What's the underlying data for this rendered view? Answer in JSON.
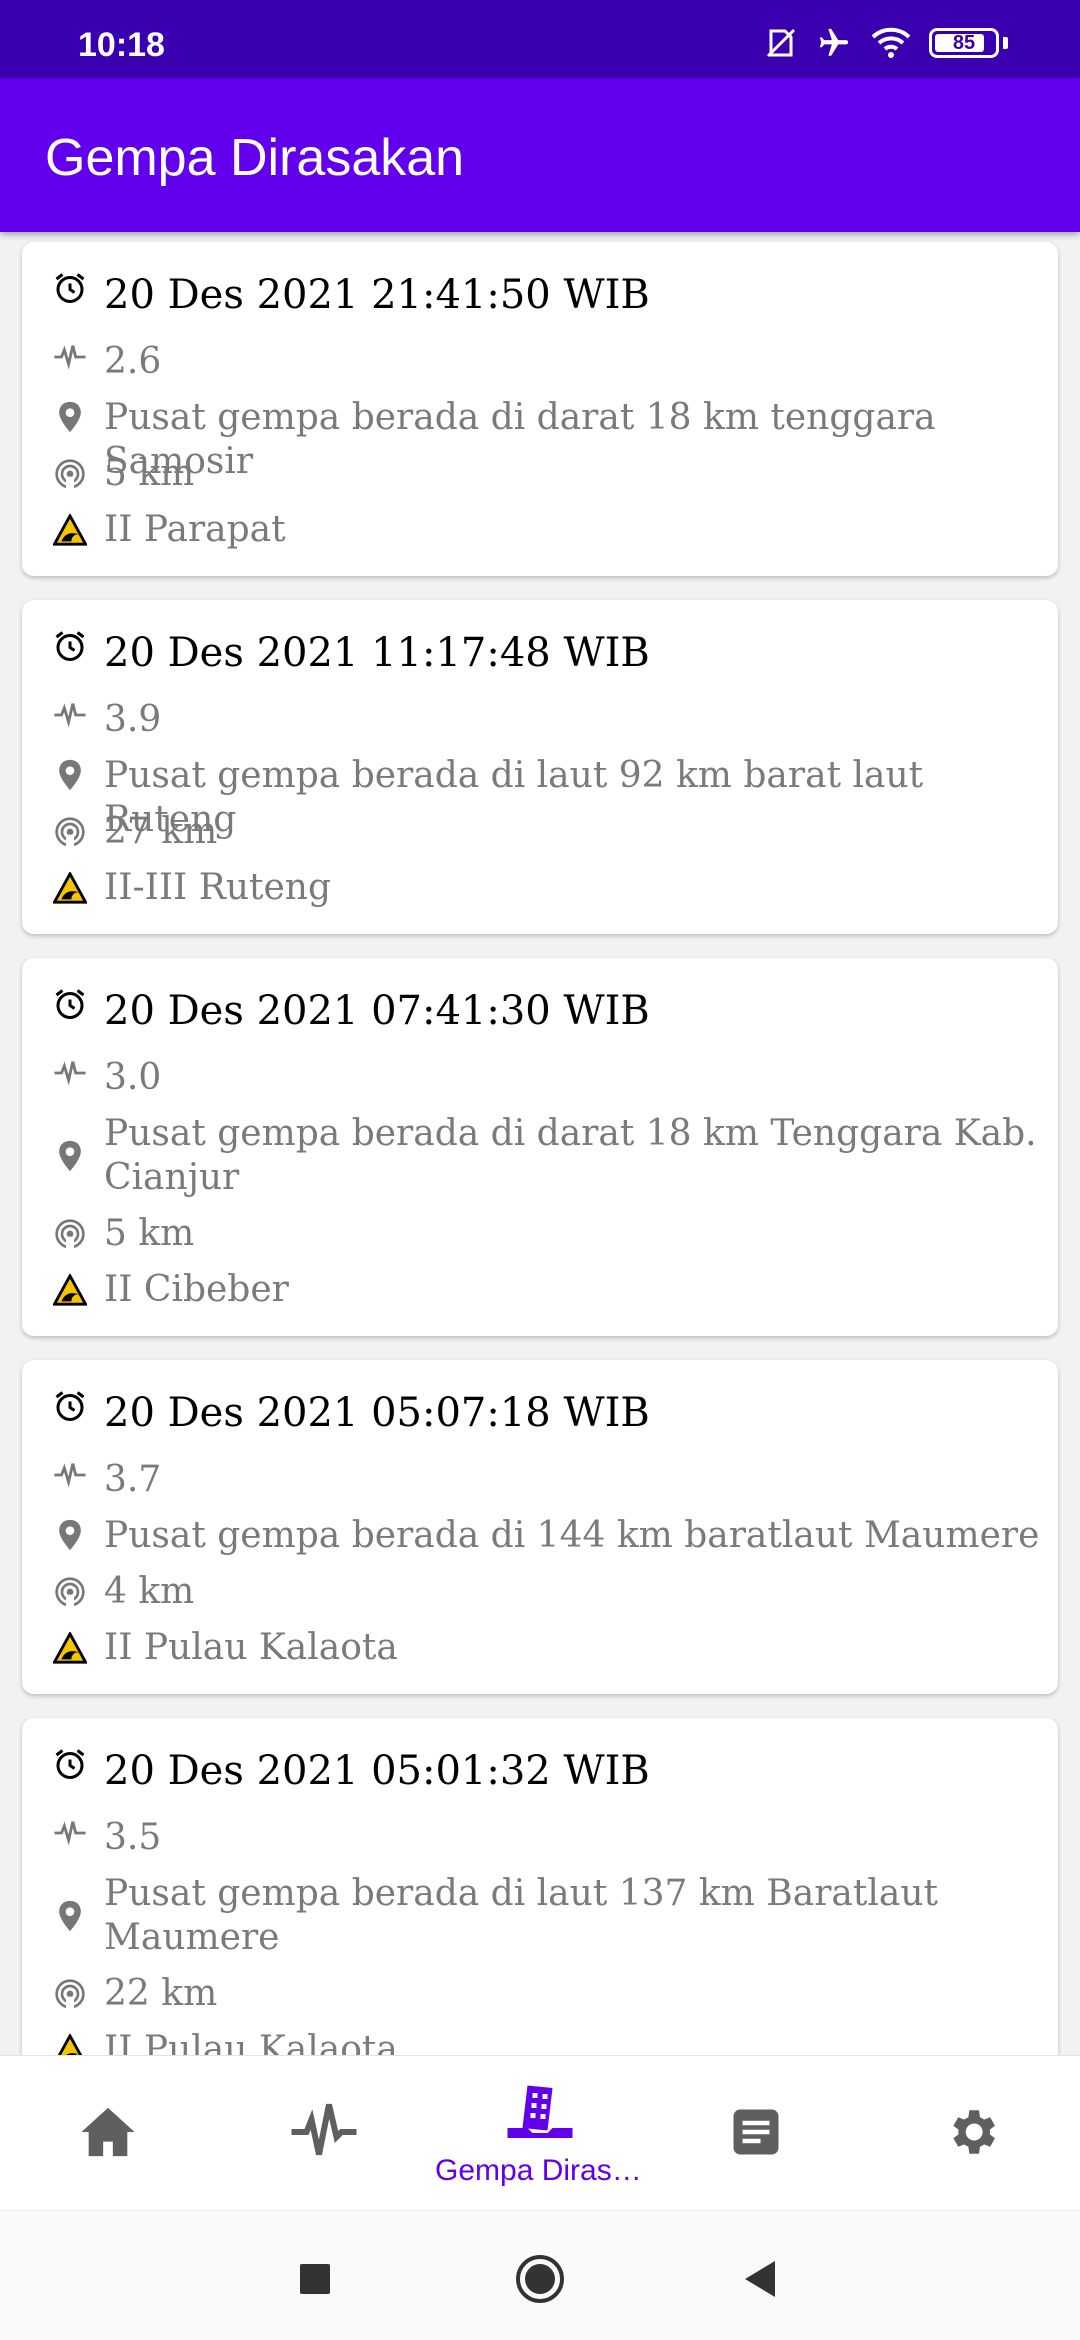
{
  "status_bar": {
    "time": "10:18",
    "battery": "85",
    "battery_level": 0.85,
    "icons": [
      "no-sim-icon",
      "airplane-icon",
      "wifi-icon",
      "battery-icon"
    ]
  },
  "app_bar": {
    "title": "Gempa Dirasakan"
  },
  "earthquakes": [
    {
      "time": "20 Des 2021 21:41:50 WIB",
      "magnitude": "2.6",
      "location": "Pusat gempa berada di darat 18 km tenggara Samosir",
      "depth": "5 km",
      "felt": "II Parapat"
    },
    {
      "time": "20 Des 2021 11:17:48 WIB",
      "magnitude": "3.9",
      "location": "Pusat gempa berada di laut 92 km barat laut Ruteng",
      "depth": "27 km",
      "felt": "II-III Ruteng"
    },
    {
      "time": "20 Des 2021 07:41:30 WIB",
      "magnitude": "3.0",
      "location": "Pusat gempa berada di darat 18 km Tenggara Kab. Cianjur",
      "depth": "5 km",
      "felt": "II Cibeber"
    },
    {
      "time": "20 Des 2021 05:07:18 WIB",
      "magnitude": "3.7",
      "location": "Pusat gempa berada di 144 km baratlaut Maumere",
      "depth": "4 km",
      "felt": "II Pulau Kalaota"
    },
    {
      "time": "20 Des 2021 05:01:32 WIB",
      "magnitude": "3.5",
      "location": "Pusat gempa berada di laut 137 km Baratlaut Maumere",
      "depth": "22 km",
      "felt": "II Pulau Kalaota"
    }
  ],
  "bottom_nav": {
    "items": [
      {
        "icon": "home-icon",
        "label": ""
      },
      {
        "icon": "pulse-icon",
        "label": ""
      },
      {
        "icon": "building-quake-icon",
        "label": "Gempa Dirasakan",
        "active": true
      },
      {
        "icon": "article-icon",
        "label": ""
      },
      {
        "icon": "gear-icon",
        "label": ""
      }
    ]
  },
  "colors": {
    "status_bar": "#3a00b0",
    "app_bar": "#6200ee",
    "accent": "#6200ee",
    "nav_icon": "#5f5f5f",
    "warning_yellow": "#f5c400"
  }
}
